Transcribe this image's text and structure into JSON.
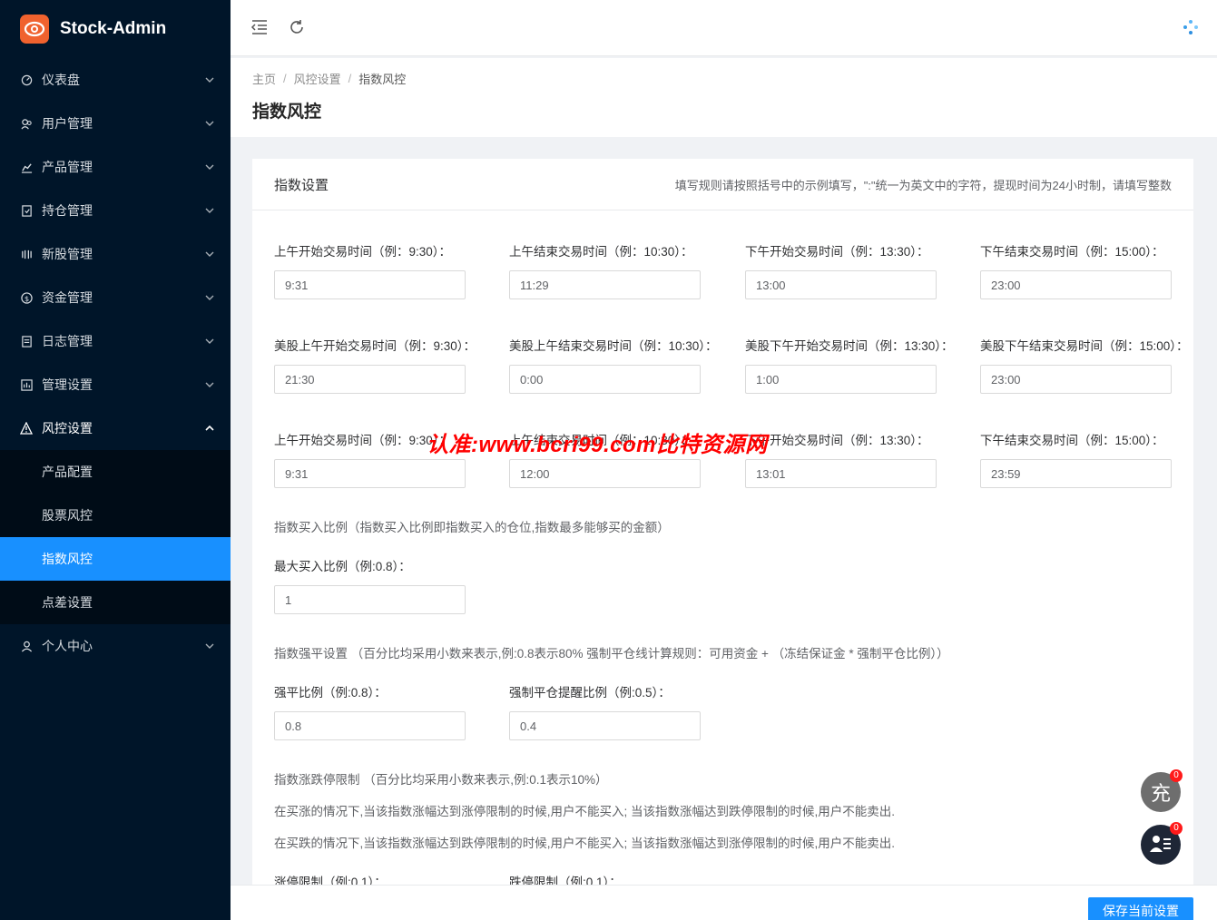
{
  "app": {
    "title": "Stock-Admin"
  },
  "sidebar": {
    "items": [
      {
        "label": "仪表盘",
        "icon": "dashboard-icon"
      },
      {
        "label": "用户管理",
        "icon": "users-icon"
      },
      {
        "label": "产品管理",
        "icon": "chart-icon"
      },
      {
        "label": "持仓管理",
        "icon": "position-icon"
      },
      {
        "label": "新股管理",
        "icon": "ipo-icon"
      },
      {
        "label": "资金管理",
        "icon": "money-icon"
      },
      {
        "label": "日志管理",
        "icon": "log-icon"
      },
      {
        "label": "管理设置",
        "icon": "settings-icon"
      },
      {
        "label": "风控设置",
        "icon": "warning-icon"
      },
      {
        "label": "个人中心",
        "icon": "user-icon"
      }
    ],
    "risk_submenu": [
      "产品配置",
      "股票风控",
      "指数风控",
      "点差设置"
    ],
    "active_sub": "指数风控"
  },
  "breadcrumb": {
    "home": "主页",
    "parent": "风控设置",
    "current": "指数风控"
  },
  "page_title": "指数风控",
  "card": {
    "title": "指数设置",
    "hint": "填写规则请按照括号中的示例填写，\":\"统一为英文中的字符，提现时间为24小时制，请填写整数"
  },
  "row1": {
    "labels": [
      "上午开始交易时间（例：9:30）：",
      "上午结束交易时间（例：10:30）：",
      "下午开始交易时间（例：13:30）：",
      "下午结束交易时间（例：15:00）："
    ],
    "values": [
      "9:31",
      "11:29",
      "13:00",
      "23:00"
    ]
  },
  "row2": {
    "labels": [
      "美股上午开始交易时间（例：9:30）：",
      "美股上午结束交易时间（例：10:30）：",
      "美股下午开始交易时间（例：13:30）：",
      "美股下午结束交易时间（例：15:00）："
    ],
    "values": [
      "21:30",
      "0:00",
      "1:00",
      "23:00"
    ]
  },
  "row3": {
    "labels": [
      "上午开始交易时间（例：9:30）：",
      "上午结束交易时间（例：10:30）：",
      "下午开始交易时间（例：13:30）：",
      "下午结束交易时间（例：15:00）："
    ],
    "values": [
      "9:31",
      "12:00",
      "13:01",
      "23:59"
    ]
  },
  "buy_ratio": {
    "note": "指数买入比例（指数买入比例即指数买入的仓位,指数最多能够买的金额）",
    "label": "最大买入比例（例:0.8）：",
    "value": "1"
  },
  "force_close": {
    "note": "指数强平设置 （百分比均采用小数来表示,例:0.8表示80% 强制平仓线计算规则：可用资金 + （冻结保证金 * 强制平仓比例））",
    "labels": [
      "强平比例（例:0.8）：",
      "强制平仓提醒比例（例:0.5）："
    ],
    "values": [
      "0.8",
      "0.4"
    ]
  },
  "limit": {
    "note": "指数涨跌停限制 （百分比均采用小数来表示,例:0.1表示10%）",
    "desc1": "在买涨的情况下,当该指数涨幅达到涨停限制的时候,用户不能买入; 当该指数涨幅达到跌停限制的时候,用户不能卖出.",
    "desc2": "在买跌的情况下,当该指数涨幅达到跌停限制的时候,用户不能买入; 当该指数涨幅达到涨停限制的时候,用户不能卖出.",
    "labels": [
      "涨停限制（例:0.1）：",
      "跌停限制（例:0.1）："
    ]
  },
  "watermark": "认准:www.bcri99.com比特资源网",
  "save_label": "保存当前设置",
  "float": {
    "recharge_label": "充",
    "recharge_badge": "0",
    "chat_badge": "0"
  },
  "colors": {
    "sidebar_bg": "#001529",
    "active": "#1890ff",
    "badge": "#ff1a1a"
  }
}
